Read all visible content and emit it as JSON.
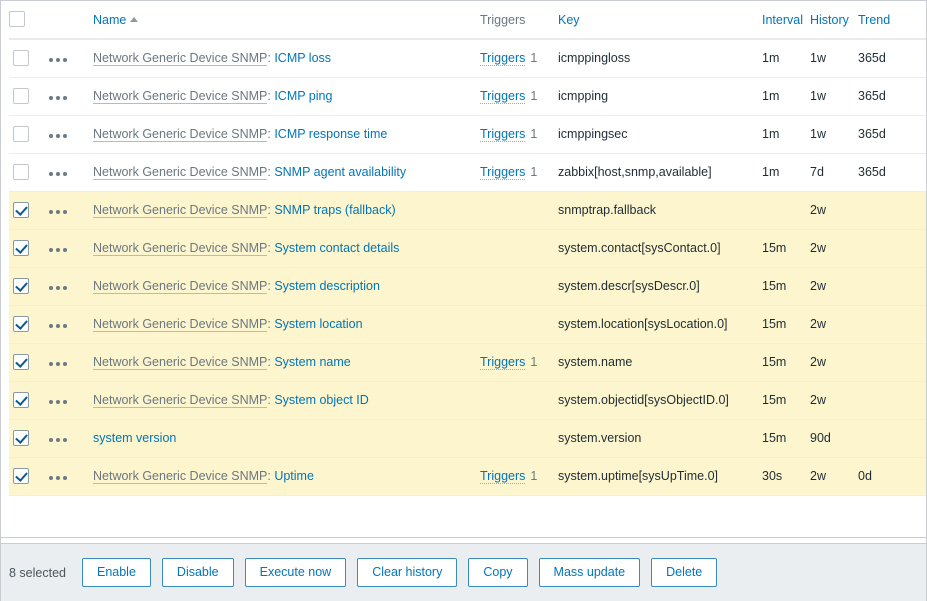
{
  "table": {
    "columns": [
      {
        "key": "check",
        "label": "",
        "link": false
      },
      {
        "key": "menu",
        "label": "",
        "link": false
      },
      {
        "key": "name",
        "label": "Name",
        "link": true,
        "sorted": "asc"
      },
      {
        "key": "triggers",
        "label": "Triggers",
        "link": false
      },
      {
        "key": "key",
        "label": "Key",
        "link": true
      },
      {
        "key": "interval",
        "label": "Interval",
        "link": true
      },
      {
        "key": "history",
        "label": "History",
        "link": true
      },
      {
        "key": "trend",
        "label": "Trend",
        "link": true
      }
    ],
    "header_select_all_checked": false,
    "rows": [
      {
        "selected": false,
        "template": "Network Generic Device SNMP",
        "name": "ICMP loss",
        "triggers_label": "Triggers",
        "triggers_count": "1",
        "key": "icmppingloss",
        "interval": "1m",
        "history": "1w",
        "trend": "365d"
      },
      {
        "selected": false,
        "template": "Network Generic Device SNMP",
        "name": "ICMP ping",
        "triggers_label": "Triggers",
        "triggers_count": "1",
        "key": "icmpping",
        "interval": "1m",
        "history": "1w",
        "trend": "365d"
      },
      {
        "selected": false,
        "template": "Network Generic Device SNMP",
        "name": "ICMP response time",
        "triggers_label": "Triggers",
        "triggers_count": "1",
        "key": "icmppingsec",
        "interval": "1m",
        "history": "1w",
        "trend": "365d"
      },
      {
        "selected": false,
        "template": "Network Generic Device SNMP",
        "name": "SNMP agent availability",
        "triggers_label": "Triggers",
        "triggers_count": "1",
        "key": "zabbix[host,snmp,available]",
        "interval": "1m",
        "history": "7d",
        "trend": "365d"
      },
      {
        "selected": true,
        "template": "Network Generic Device SNMP",
        "name": "SNMP traps (fallback)",
        "triggers_label": "",
        "triggers_count": "",
        "key": "snmptrap.fallback",
        "interval": "",
        "history": "2w",
        "trend": ""
      },
      {
        "selected": true,
        "template": "Network Generic Device SNMP",
        "name": "System contact details",
        "triggers_label": "",
        "triggers_count": "",
        "key": "system.contact[sysContact.0]",
        "interval": "15m",
        "history": "2w",
        "trend": ""
      },
      {
        "selected": true,
        "template": "Network Generic Device SNMP",
        "name": "System description",
        "triggers_label": "",
        "triggers_count": "",
        "key": "system.descr[sysDescr.0]",
        "interval": "15m",
        "history": "2w",
        "trend": ""
      },
      {
        "selected": true,
        "template": "Network Generic Device SNMP",
        "name": "System location",
        "triggers_label": "",
        "triggers_count": "",
        "key": "system.location[sysLocation.0]",
        "interval": "15m",
        "history": "2w",
        "trend": ""
      },
      {
        "selected": true,
        "template": "Network Generic Device SNMP",
        "name": "System name",
        "triggers_label": "Triggers",
        "triggers_count": "1",
        "key": "system.name",
        "interval": "15m",
        "history": "2w",
        "trend": ""
      },
      {
        "selected": true,
        "template": "Network Generic Device SNMP",
        "name": "System object ID",
        "triggers_label": "",
        "triggers_count": "",
        "key": "system.objectid[sysObjectID.0]",
        "interval": "15m",
        "history": "2w",
        "trend": ""
      },
      {
        "selected": true,
        "template": "",
        "name": "system version",
        "triggers_label": "",
        "triggers_count": "",
        "key": "system.version",
        "interval": "15m",
        "history": "90d",
        "trend": ""
      },
      {
        "selected": true,
        "template": "Network Generic Device SNMP",
        "name": "Uptime",
        "triggers_label": "Triggers",
        "triggers_count": "1",
        "key": "system.uptime[sysUpTime.0]",
        "interval": "30s",
        "history": "2w",
        "trend": "0d"
      }
    ]
  },
  "footer": {
    "selected_text": "8 selected",
    "buttons": [
      {
        "id": "enable",
        "label": "Enable"
      },
      {
        "id": "disable",
        "label": "Disable"
      },
      {
        "id": "execute-now",
        "label": "Execute now"
      },
      {
        "id": "clear-history",
        "label": "Clear history"
      },
      {
        "id": "copy",
        "label": "Copy"
      },
      {
        "id": "mass-update",
        "label": "Mass update"
      },
      {
        "id": "delete",
        "label": "Delete"
      }
    ]
  },
  "colors": {
    "link": "#0275b8",
    "selected_row": "#fcf5ce",
    "muted_text": "#6c7780",
    "footer_bg": "#ebeef0",
    "border": "#c9cdd1"
  },
  "icons": {
    "kebab": "kebab-menu-icon",
    "sort_asc": "sort-ascending-icon",
    "checkbox_checked": "checkbox-checked-icon",
    "checkbox_unchecked": "checkbox-unchecked-icon"
  }
}
